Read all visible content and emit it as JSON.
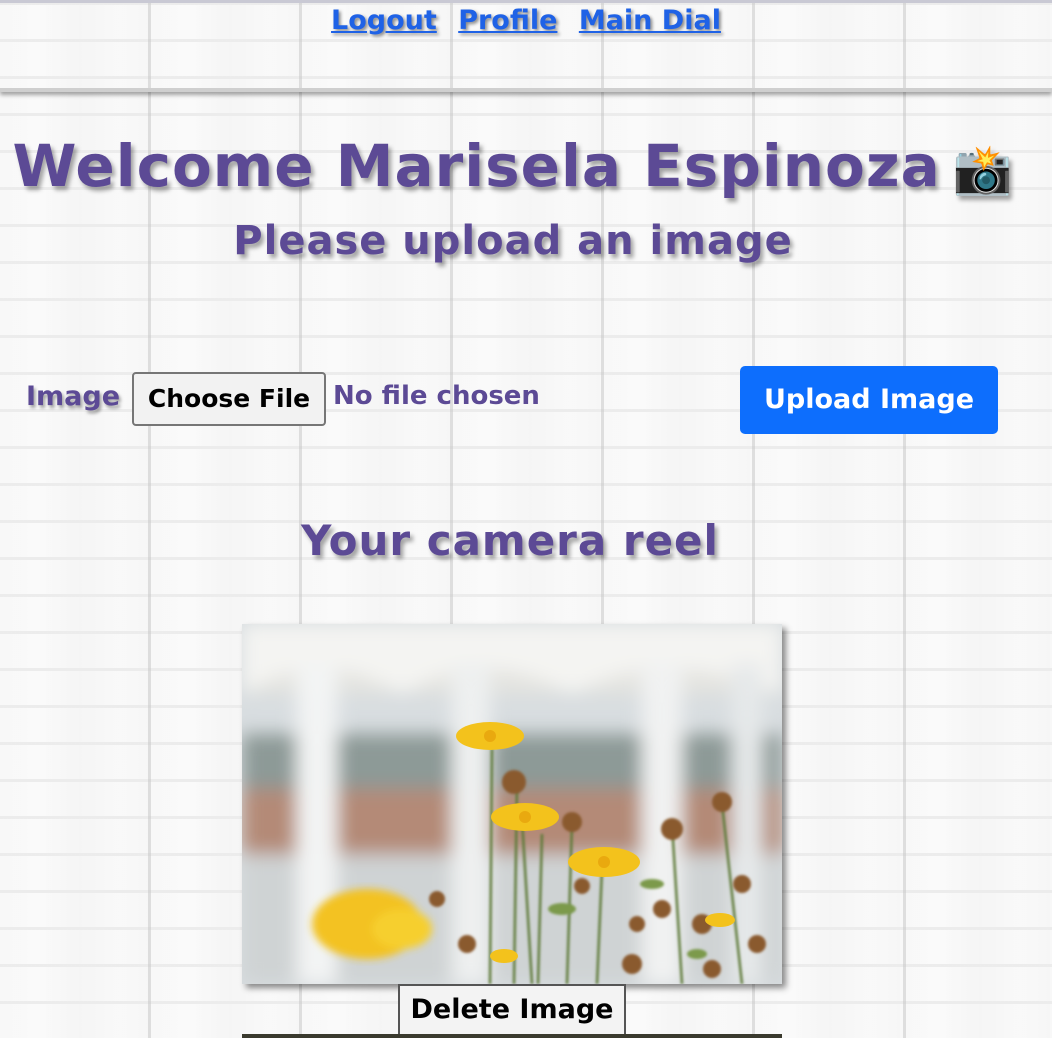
{
  "nav": {
    "links": [
      "Logout",
      "Profile",
      "Main Dial"
    ]
  },
  "header": {
    "welcome": "Welcome Marisela Espinoza",
    "camera_emoji": "📸",
    "subtitle": "Please upload an image"
  },
  "upload_form": {
    "image_label": "Image",
    "choose_file_label": "Choose File",
    "no_file_text": "No file chosen",
    "upload_button_label": "Upload Image"
  },
  "reel": {
    "heading": "Your camera reel",
    "images": [
      {
        "description_icon": "photo-yellow-flowers",
        "delete_label": "Delete Image"
      }
    ]
  },
  "colors": {
    "heading_purple": "#5c4a95",
    "link_blue": "#1f62e6",
    "primary_button": "#0d6efd"
  }
}
